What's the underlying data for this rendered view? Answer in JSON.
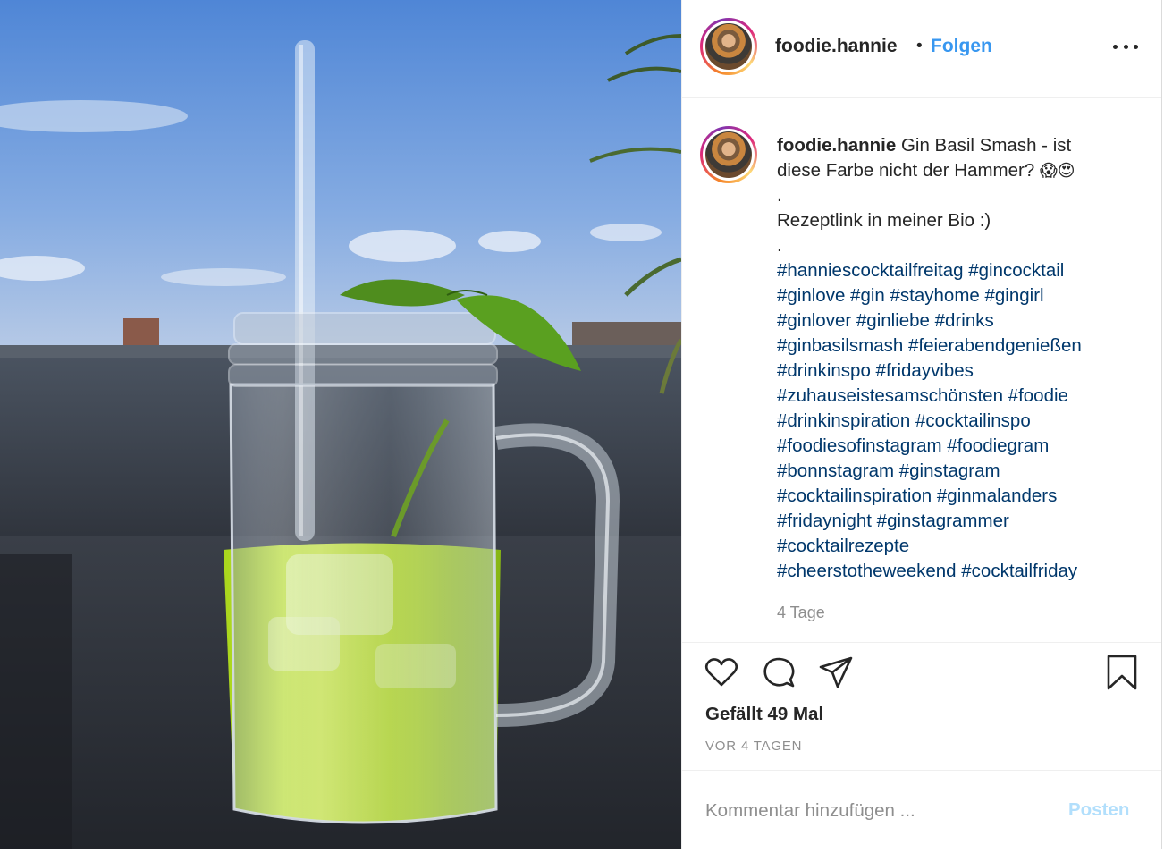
{
  "post": {
    "username": "foodie.hannie",
    "separator": "•",
    "follow_label": "Folgen",
    "caption": {
      "username": "foodie.hannie",
      "first_line": "Gin Basil Smash - ist",
      "second_line": "diese Farbe nicht der Hammer?",
      "emojis": "😱😍",
      "dot1": ".",
      "line3": "Rezeptlink in meiner Bio :)",
      "dot2": ".",
      "hashtag_lines": [
        "#hanniescocktailfreitag #gincocktail",
        "#ginlove #gin #stayhome #gingirl",
        "#ginlover #ginliebe #drinks",
        "#ginbasilsmash #feierabendgenießen",
        "#drinkinspo #fridayvibes",
        "#zuhauseistesamschönsten #foodie",
        "#drinkinspiration #cocktailinspo",
        "#foodiesofinstagram #foodiegram",
        "#bonnstagram #ginstagram",
        "#cocktailinspiration #ginmalanders",
        "#fridaynight #ginstagrammer",
        "#cocktailrezepte",
        "#cheerstotheweekend #cocktailfriday"
      ]
    },
    "caption_time": "4 Tage",
    "likes": "Gefällt 49 Mal",
    "date": "VOR 4 TAGEN",
    "comment": {
      "placeholder": "Kommentar hinzufügen ...",
      "post_label": "Posten"
    }
  },
  "icons": {
    "more": "more-options-icon",
    "like": "heart-icon",
    "comment": "comment-bubble-icon",
    "share": "paper-plane-icon",
    "save": "bookmark-icon"
  },
  "colors": {
    "link_blue": "#3897f0",
    "hashtag": "#00376b",
    "secondary_text": "#8e8e8e",
    "post_disabled": "#b2dffc"
  }
}
